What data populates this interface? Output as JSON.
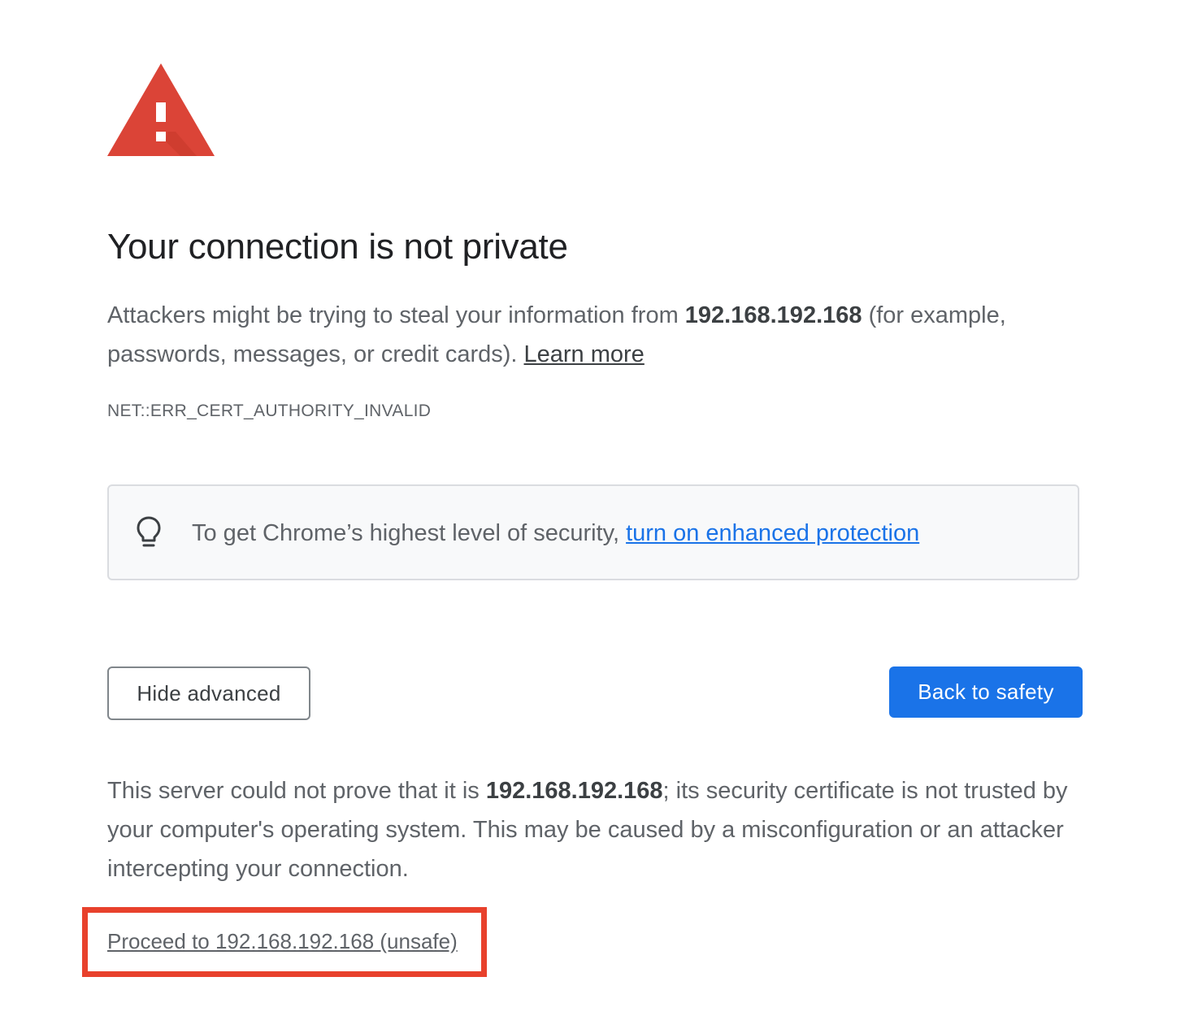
{
  "warning_icon": {
    "name": "warning-triangle-icon",
    "color": "#db4437"
  },
  "heading": "Your connection is not private",
  "intro": {
    "text_before": "Attackers might be trying to steal your information from ",
    "host": "192.168.192.168",
    "text_after": " (for example, passwords, messages, or credit cards). ",
    "learn_more": "Learn more"
  },
  "error_code": "NET::ERR_CERT_AUTHORITY_INVALID",
  "enhanced_protection": {
    "icon": "lightbulb-icon",
    "text": "To get Chrome’s highest level of security, ",
    "link": "turn on enhanced protection"
  },
  "buttons": {
    "hide_advanced": "Hide advanced",
    "back_to_safety": "Back to safety"
  },
  "details": {
    "text_before": "This server could not prove that it is ",
    "host": "192.168.192.168",
    "text_after": "; its security certificate is not trusted by your computer's operating system. This may be caused by a misconfiguration or an attacker intercepting your connection."
  },
  "proceed_link": "Proceed to 192.168.192.168 (unsafe)",
  "colors": {
    "primary_button": "#1a73e8",
    "highlight_box": "#e8412c",
    "link_blue": "#1a73e8"
  }
}
